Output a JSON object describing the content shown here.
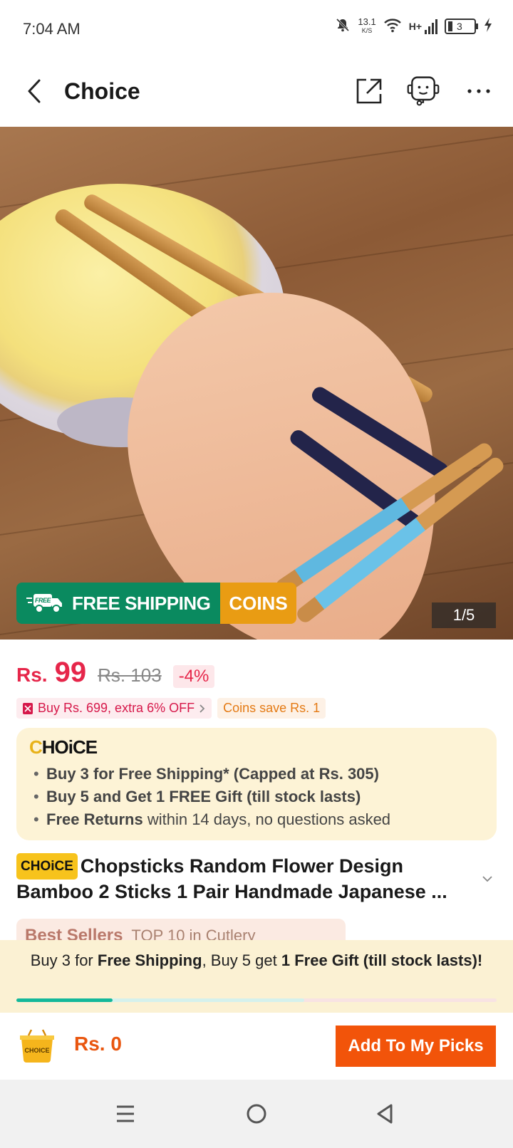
{
  "status_bar": {
    "time": "7:04 AM",
    "net_speed": "13.1",
    "net_unit": "K/S",
    "network": "H+",
    "battery": "3",
    "icons": [
      "bell-muted-icon",
      "wifi-icon",
      "signal-icon",
      "battery-icon",
      "charging-icon"
    ]
  },
  "header": {
    "title": "Choice",
    "icons": [
      "back-icon",
      "share-icon",
      "support-agent-icon",
      "more-icon"
    ]
  },
  "hero": {
    "badge_free": "FREE",
    "free_shipping": "FREE SHIPPING",
    "coins": "COINS",
    "counter": "1/5"
  },
  "price": {
    "currency": "Rs.",
    "value": "99",
    "original": "Rs. 103",
    "discount": "-4%"
  },
  "promo": {
    "deal": "Buy Rs. 699, extra 6% OFF",
    "coins": "Coins save Rs. 1"
  },
  "choice_box": {
    "logo_c": "C",
    "logo_rest": "HOiCE",
    "items": [
      {
        "bold": "Buy 3 for  Free Shipping* (Capped at Rs. 305)",
        "rest": ""
      },
      {
        "bold": "Buy 5 and Get 1 FREE Gift (till stock lasts)",
        "rest": ""
      },
      {
        "bold": "Free Returns",
        "rest": " within 14 days, no questions asked"
      }
    ]
  },
  "product": {
    "chip": "CHOiCE",
    "title": "Chopsticks Random Flower Design Bamboo 2 Sticks 1 Pair Handmade Japanese ..."
  },
  "best_sellers": {
    "label": "Best Sellers",
    "rank": "TOP 10 in Cutlery"
  },
  "shipping_panel": {
    "t1": "Buy 3 for ",
    "b1": "Free Shipping",
    "t2": ", Buy 5 get ",
    "b2": "1 Free Gift (till stock lasts)!",
    "progress_fraction": 0.2
  },
  "action_bar": {
    "cart_label": "CHOICE",
    "total": "Rs. 0",
    "add_button": "Add To My Picks"
  },
  "colors": {
    "accent_red": "#e6264a",
    "action_orange": "#f2540a",
    "shipping_green": "#0a8a5f",
    "coins_gold": "#e99c13",
    "choice_yellow": "#f7c31c"
  }
}
